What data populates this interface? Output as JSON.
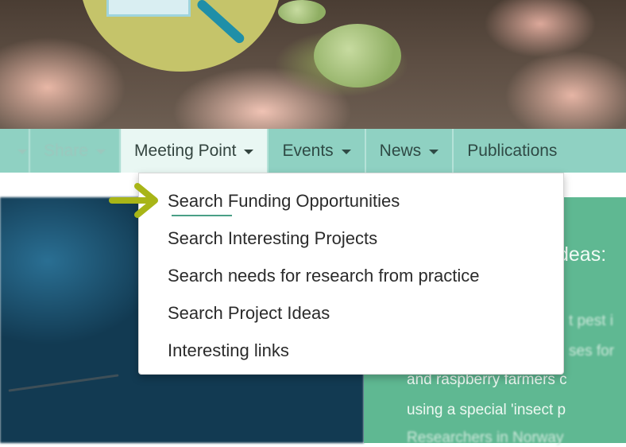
{
  "nav": {
    "items": [
      {
        "label": "Share",
        "state": "faded"
      },
      {
        "label": "Meeting Point",
        "state": "active"
      },
      {
        "label": "Events",
        "state": "normal"
      },
      {
        "label": "News",
        "state": "normal"
      },
      {
        "label": "Publications",
        "state": "cut-off"
      }
    ]
  },
  "dropdown": {
    "items": [
      "Search Funding Opportunities",
      "Search Interesting Projects",
      "Search needs for research from practice",
      "Search Project Ideas",
      "Interesting links"
    ]
  },
  "panel": {
    "title": "deas:",
    "lines": [
      "t pest i",
      "ses for",
      "and raspberry farmers c",
      "using a special 'insect p",
      "Researchers in Norway"
    ]
  },
  "colors": {
    "navbar": "#8fd1c2",
    "active_tab": "#e9f7f3",
    "panel_green": "#5fb892",
    "arrow": "#a8b517",
    "logo_circle": "#c5c46a"
  },
  "icons": [
    "caret-down-icon",
    "pointer-arrow-icon",
    "magnifier-logo-icon"
  ]
}
